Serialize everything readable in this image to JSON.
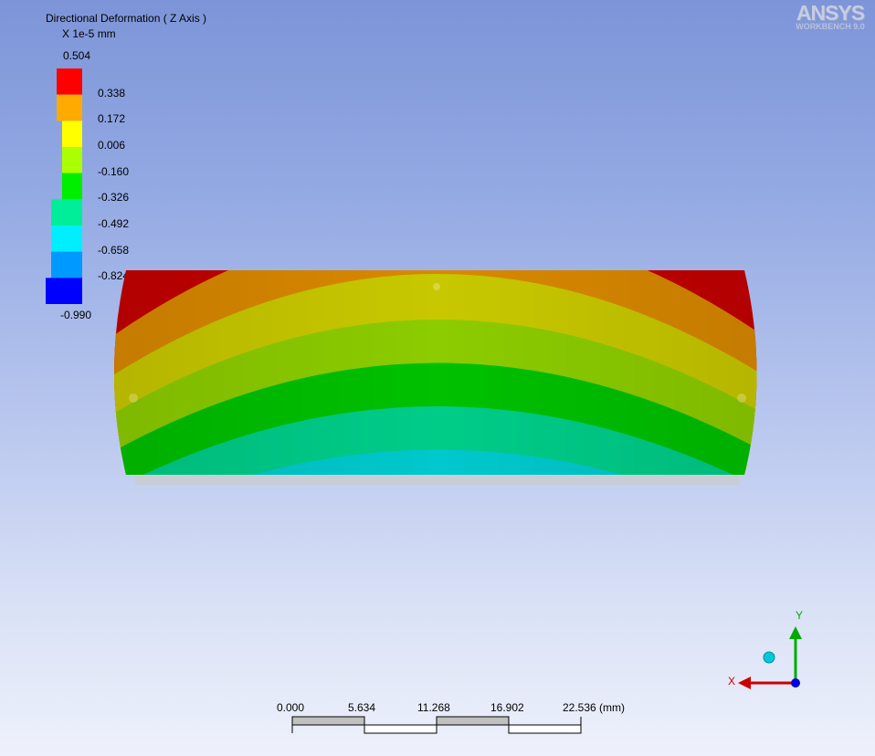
{
  "legend": {
    "title": "Directional Deformation ( Z Axis )",
    "units": "X 1e-5 mm",
    "max": "0.504",
    "min": "-0.990",
    "levels": [
      "0.338",
      "0.172",
      "0.006",
      "-0.160",
      "-0.326",
      "-0.492",
      "-0.658",
      "-0.824"
    ],
    "colors": [
      "#ff0000",
      "#ffaa00",
      "#ffff00",
      "#aaff00",
      "#00ee00",
      "#00ee99",
      "#00eeff",
      "#0099ff",
      "#0000ff"
    ]
  },
  "logo": {
    "brand": "ANSYS",
    "product": "WORKBENCH 9.0"
  },
  "scale_bar": {
    "ticks": [
      "0.000",
      "5.634",
      "11.268",
      "16.902",
      "22.536 (mm)"
    ]
  },
  "triad": {
    "y_label": "Y",
    "x_label": "X"
  }
}
